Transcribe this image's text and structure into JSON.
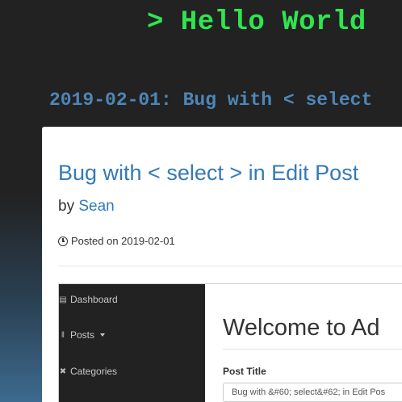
{
  "header": {
    "site_title": "> Hello World",
    "post_heading": "2019-02-01: Bug with < select"
  },
  "post": {
    "title": "Bug with < select > in Edit Post",
    "by_label": "by",
    "author": "Sean",
    "posted_label": "Posted on 2019-02-01"
  },
  "embedded_screenshot": {
    "sidebar": {
      "items": [
        {
          "label": "Dashboard",
          "icon": "dashboard-icon"
        },
        {
          "label": "Posts",
          "icon": "pin-icon"
        },
        {
          "label": "Categories",
          "icon": "wrench-icon"
        }
      ]
    },
    "main": {
      "heading": "Welcome to Ad",
      "field_label": "Post Title",
      "field_value": "Bug with &#60; select&#62; in Edit Pos"
    }
  }
}
